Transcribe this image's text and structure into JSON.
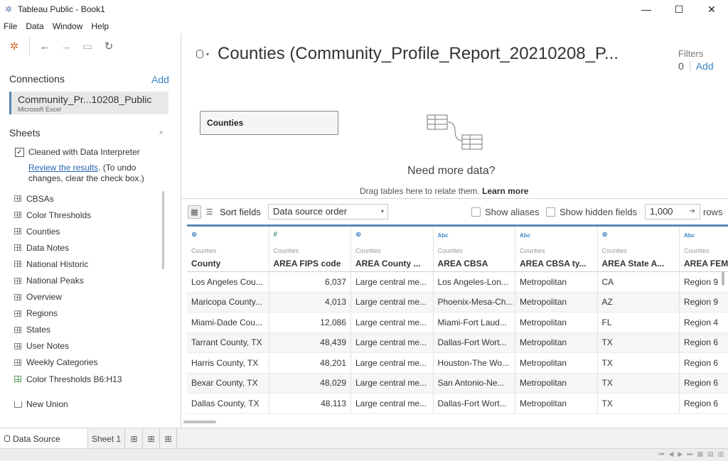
{
  "window": {
    "title": "Tableau Public - Book1",
    "minimize_glyph": "—",
    "maximize_glyph": "☐",
    "close_glyph": "✕",
    "app_icon": "✲"
  },
  "menu": [
    "File",
    "Data",
    "Window",
    "Help"
  ],
  "toolbar": {
    "logo_icon": "✲",
    "back_icon": "←",
    "forward_icon": "→",
    "save_icon": "▭",
    "refresh_icon": "↻"
  },
  "connections": {
    "heading": "Connections",
    "add_label": "Add",
    "items": [
      {
        "name": "Community_Pr...10208_Public",
        "type": "Microsoft Excel"
      }
    ]
  },
  "sheets": {
    "heading": "Sheets",
    "search_icon": "⌕",
    "interpreter": {
      "checked_mark": "✓",
      "label": "Cleaned with Data Interpreter",
      "link": "Review the results",
      "note": ". (To undo changes, clear the check box.)"
    },
    "items": [
      "CBSAs",
      "Color Thresholds",
      "Counties",
      "Data Notes",
      "National Historic",
      "National Peaks",
      "Overview",
      "Regions",
      "States",
      "User Notes",
      "Weekly Categories",
      "Color Thresholds B6:H13"
    ],
    "new_union": "New Union"
  },
  "datasource": {
    "title": "Counties (Community_Profile_Report_20210208_P...",
    "caret": "▾",
    "filters_label": "Filters",
    "filters_count": "0",
    "filters_add": "Add"
  },
  "canvas": {
    "table_chip": "Counties",
    "need_more": "Need more data?",
    "drag_hint": "Drag tables here to relate them.",
    "learn_more": "Learn more"
  },
  "grid_toolbar": {
    "grid_view_icon": "▦",
    "list_view_icon": "☰",
    "sort_label": "Sort fields",
    "sort_value": "Data source order",
    "sort_caret": "▾",
    "show_aliases": "Show aliases",
    "show_hidden": "Show hidden fields",
    "rows_value": "1,000",
    "rows_arrow": "➔",
    "rows_label": "rows"
  },
  "table": {
    "columns": [
      {
        "type": "⊕",
        "source": "Counties",
        "name": "County"
      },
      {
        "type": "#",
        "source": "Counties",
        "name": "AREA FIPS code"
      },
      {
        "type": "⊕",
        "source": "Counties",
        "name": "AREA County ..."
      },
      {
        "type": "Abc",
        "source": "Counties",
        "name": "AREA CBSA"
      },
      {
        "type": "Abc",
        "source": "Counties",
        "name": "AREA CBSA ty..."
      },
      {
        "type": "⊕",
        "source": "Counties",
        "name": "AREA State A..."
      },
      {
        "type": "Abc",
        "source": "Counties",
        "name": "AREA FEMA"
      }
    ],
    "rows": [
      [
        "Los Angeles Cou...",
        "6,037",
        "Large central me...",
        "Los Angeles-Lon...",
        "Metropolitan",
        "CA",
        "Region 9"
      ],
      [
        "Maricopa County...",
        "4,013",
        "Large central me...",
        "Phoenix-Mesa-Ch...",
        "Metropolitan",
        "AZ",
        "Region 9"
      ],
      [
        "Miami-Dade Cou...",
        "12,086",
        "Large central me...",
        "Miami-Fort Laud...",
        "Metropolitan",
        "FL",
        "Region 4"
      ],
      [
        "Tarrant County, TX",
        "48,439",
        "Large central me...",
        "Dallas-Fort Wort...",
        "Metropolitan",
        "TX",
        "Region 6"
      ],
      [
        "Harris County, TX",
        "48,201",
        "Large central me...",
        "Houston-The Wo...",
        "Metropolitan",
        "TX",
        "Region 6"
      ],
      [
        "Bexar County, TX",
        "48,029",
        "Large central me...",
        "San Antonio-Ne...",
        "Metropolitan",
        "TX",
        "Region 6"
      ],
      [
        "Dallas County, TX",
        "48,113",
        "Large central me...",
        "Dallas-Fort Wort...",
        "Metropolitan",
        "TX",
        "Region 6"
      ]
    ]
  },
  "tabs": {
    "data_source": "Data Source",
    "sheet1": "Sheet 1",
    "new_sheet_icon": "⊞",
    "new_dashboard_icon": "⊞",
    "new_story_icon": "⊞"
  },
  "status": {
    "nav_icons": [
      "⏮",
      "◀",
      "▶",
      "⏭",
      "▦",
      "▤",
      "▥"
    ]
  }
}
